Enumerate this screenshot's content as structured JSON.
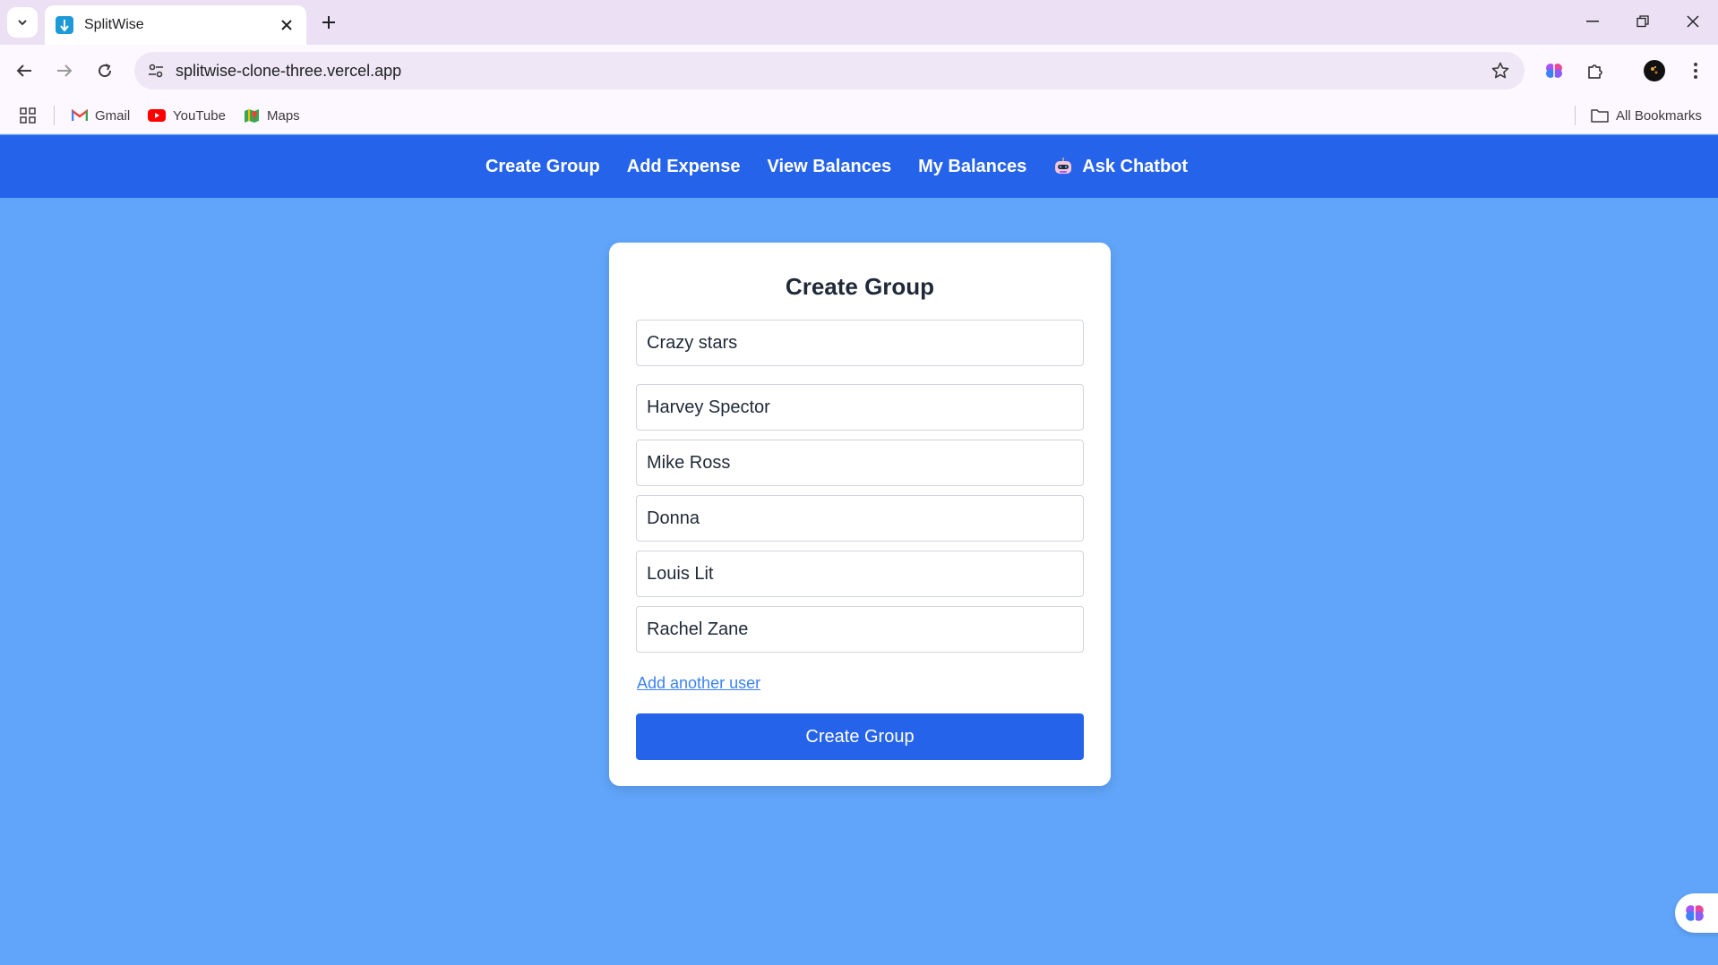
{
  "browser": {
    "tab_title": "SplitWise",
    "url": "splitwise-clone-three.vercel.app",
    "bookmarks": [
      {
        "label": "Gmail",
        "icon": "gmail-icon"
      },
      {
        "label": "YouTube",
        "icon": "youtube-icon"
      },
      {
        "label": "Maps",
        "icon": "maps-icon"
      }
    ],
    "all_bookmarks_label": "All Bookmarks"
  },
  "nav": {
    "create_group": "Create Group",
    "add_expense": "Add Expense",
    "view_balances": "View Balances",
    "my_balances": "My Balances",
    "ask_chatbot": "Ask Chatbot"
  },
  "form": {
    "title": "Create Group",
    "group_name": "Crazy stars",
    "users": [
      "Harvey Spector",
      "Mike Ross",
      "Donna",
      "Louis Lit",
      "Rachel Zane"
    ],
    "add_user_label": "Add another user",
    "submit_label": "Create Group"
  },
  "colors": {
    "page_bg": "#60a5fa",
    "nav_bg": "#2563eb",
    "button_bg": "#2563eb",
    "link": "#3b82f6"
  }
}
